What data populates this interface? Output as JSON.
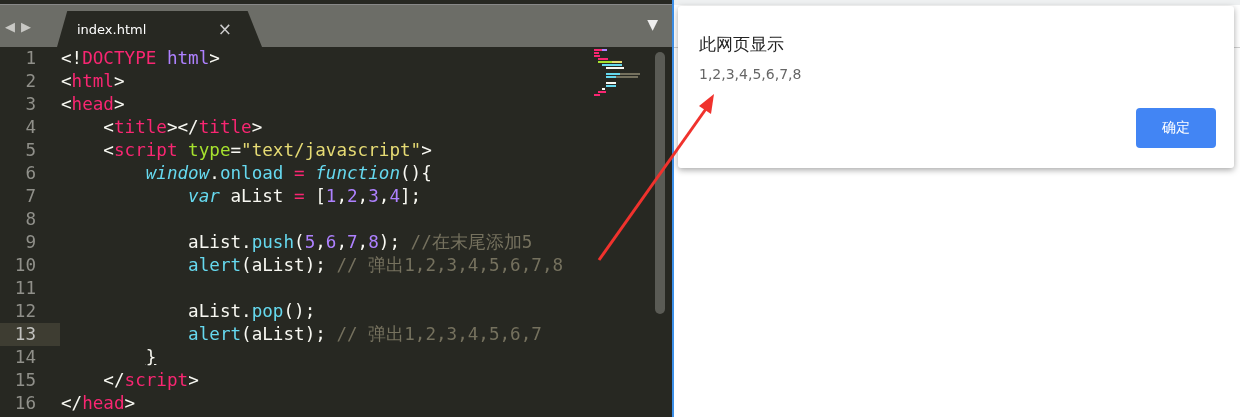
{
  "editor": {
    "nav": [
      "◀",
      "▶"
    ],
    "tabs": [
      {
        "label": "index.html",
        "close": "×",
        "selected": true
      }
    ],
    "menu": "▼",
    "lines": [
      {
        "number": "1",
        "current": false,
        "tokens": [
          {
            "kind": "punct",
            "text": "<!"
          },
          {
            "kind": "tag",
            "text": "DOCTYPE"
          },
          {
            "kind": "constant",
            "text": " html"
          },
          {
            "kind": "punct",
            "text": ">"
          }
        ]
      },
      {
        "number": "2",
        "current": false,
        "tokens": [
          {
            "kind": "punct",
            "text": "<"
          },
          {
            "kind": "tag",
            "text": "html"
          },
          {
            "kind": "punct",
            "text": ">"
          }
        ]
      },
      {
        "number": "3",
        "current": false,
        "tokens": [
          {
            "kind": "punct",
            "text": "<"
          },
          {
            "kind": "tag",
            "text": "head"
          },
          {
            "kind": "punct",
            "text": ">"
          }
        ]
      },
      {
        "number": "4",
        "current": false,
        "tokens": [
          {
            "kind": "punct",
            "text": "    <"
          },
          {
            "kind": "tag",
            "text": "title"
          },
          {
            "kind": "punct",
            "text": "></"
          },
          {
            "kind": "tag",
            "text": "title"
          },
          {
            "kind": "punct",
            "text": ">"
          }
        ]
      },
      {
        "number": "5",
        "current": false,
        "tokens": [
          {
            "kind": "punct",
            "text": "    <"
          },
          {
            "kind": "tag",
            "text": "script"
          },
          {
            "kind": "attr",
            "text": " type"
          },
          {
            "kind": "punct",
            "text": "="
          },
          {
            "kind": "string",
            "text": "\"text/javascript\""
          },
          {
            "kind": "punct",
            "text": ">"
          }
        ]
      },
      {
        "number": "6",
        "current": false,
        "tokens": [
          {
            "kind": "storage",
            "text": "        window"
          },
          {
            "kind": "punct",
            "text": "."
          },
          {
            "kind": "support",
            "text": "onload"
          },
          {
            "kind": "tag",
            "text": " = "
          },
          {
            "kind": "storage",
            "text": "function"
          },
          {
            "kind": "punct",
            "text": "(){"
          }
        ]
      },
      {
        "number": "7",
        "current": false,
        "tokens": [
          {
            "kind": "storage",
            "text": "            var"
          },
          {
            "kind": "plain",
            "text": " aList "
          },
          {
            "kind": "tag",
            "text": "="
          },
          {
            "kind": "plain",
            "text": " ["
          },
          {
            "kind": "number",
            "text": "1"
          },
          {
            "kind": "plain",
            "text": ","
          },
          {
            "kind": "number",
            "text": "2"
          },
          {
            "kind": "plain",
            "text": ","
          },
          {
            "kind": "number",
            "text": "3"
          },
          {
            "kind": "plain",
            "text": ","
          },
          {
            "kind": "number",
            "text": "4"
          },
          {
            "kind": "plain",
            "text": "];"
          }
        ]
      },
      {
        "number": "8",
        "current": false
      },
      {
        "number": "9",
        "current": false,
        "tokens": [
          {
            "kind": "plain",
            "text": "            aList."
          },
          {
            "kind": "support",
            "text": "push"
          },
          {
            "kind": "plain",
            "text": "("
          },
          {
            "kind": "number",
            "text": "5"
          },
          {
            "kind": "plain",
            "text": ","
          },
          {
            "kind": "number",
            "text": "6"
          },
          {
            "kind": "plain",
            "text": ","
          },
          {
            "kind": "number",
            "text": "7"
          },
          {
            "kind": "plain",
            "text": ","
          },
          {
            "kind": "number",
            "text": "8"
          },
          {
            "kind": "plain",
            "text": "); "
          },
          {
            "kind": "comment",
            "text": "//在末尾添加5"
          }
        ]
      },
      {
        "number": "10",
        "current": false,
        "tokens": [
          {
            "kind": "support",
            "text": "            alert"
          },
          {
            "kind": "plain",
            "text": "(aList); "
          },
          {
            "kind": "comment",
            "text": "// 弹出1,2,3,4,5,6,7,8"
          }
        ]
      },
      {
        "number": "11",
        "current": false
      },
      {
        "number": "12",
        "current": false,
        "tokens": [
          {
            "kind": "plain",
            "text": "            aList."
          },
          {
            "kind": "support",
            "text": "pop"
          },
          {
            "kind": "plain",
            "text": "();"
          }
        ]
      },
      {
        "number": "13",
        "current": true,
        "tokens": [
          {
            "kind": "support",
            "text": "            alert"
          },
          {
            "kind": "plain",
            "text": "(aList); "
          },
          {
            "kind": "comment",
            "text": "// 弹出1,2,3,4,5,6,7"
          }
        ]
      },
      {
        "number": "14",
        "current": false,
        "tokens": [
          {
            "kind": "plain",
            "text": "        }",
            "matched": true
          }
        ]
      },
      {
        "number": "15",
        "current": false,
        "tokens": [
          {
            "kind": "punct",
            "text": "    </"
          },
          {
            "kind": "tag",
            "text": "script"
          },
          {
            "kind": "punct",
            "text": ">"
          }
        ]
      },
      {
        "number": "16",
        "current": false,
        "tokens": [
          {
            "kind": "punct",
            "text": "</"
          },
          {
            "kind": "tag",
            "text": "head"
          },
          {
            "kind": "punct",
            "text": ">"
          }
        ]
      }
    ]
  },
  "dialog": {
    "title": "此网页显示",
    "message": "1,2,3,4,5,6,7,8",
    "button": "确定"
  }
}
